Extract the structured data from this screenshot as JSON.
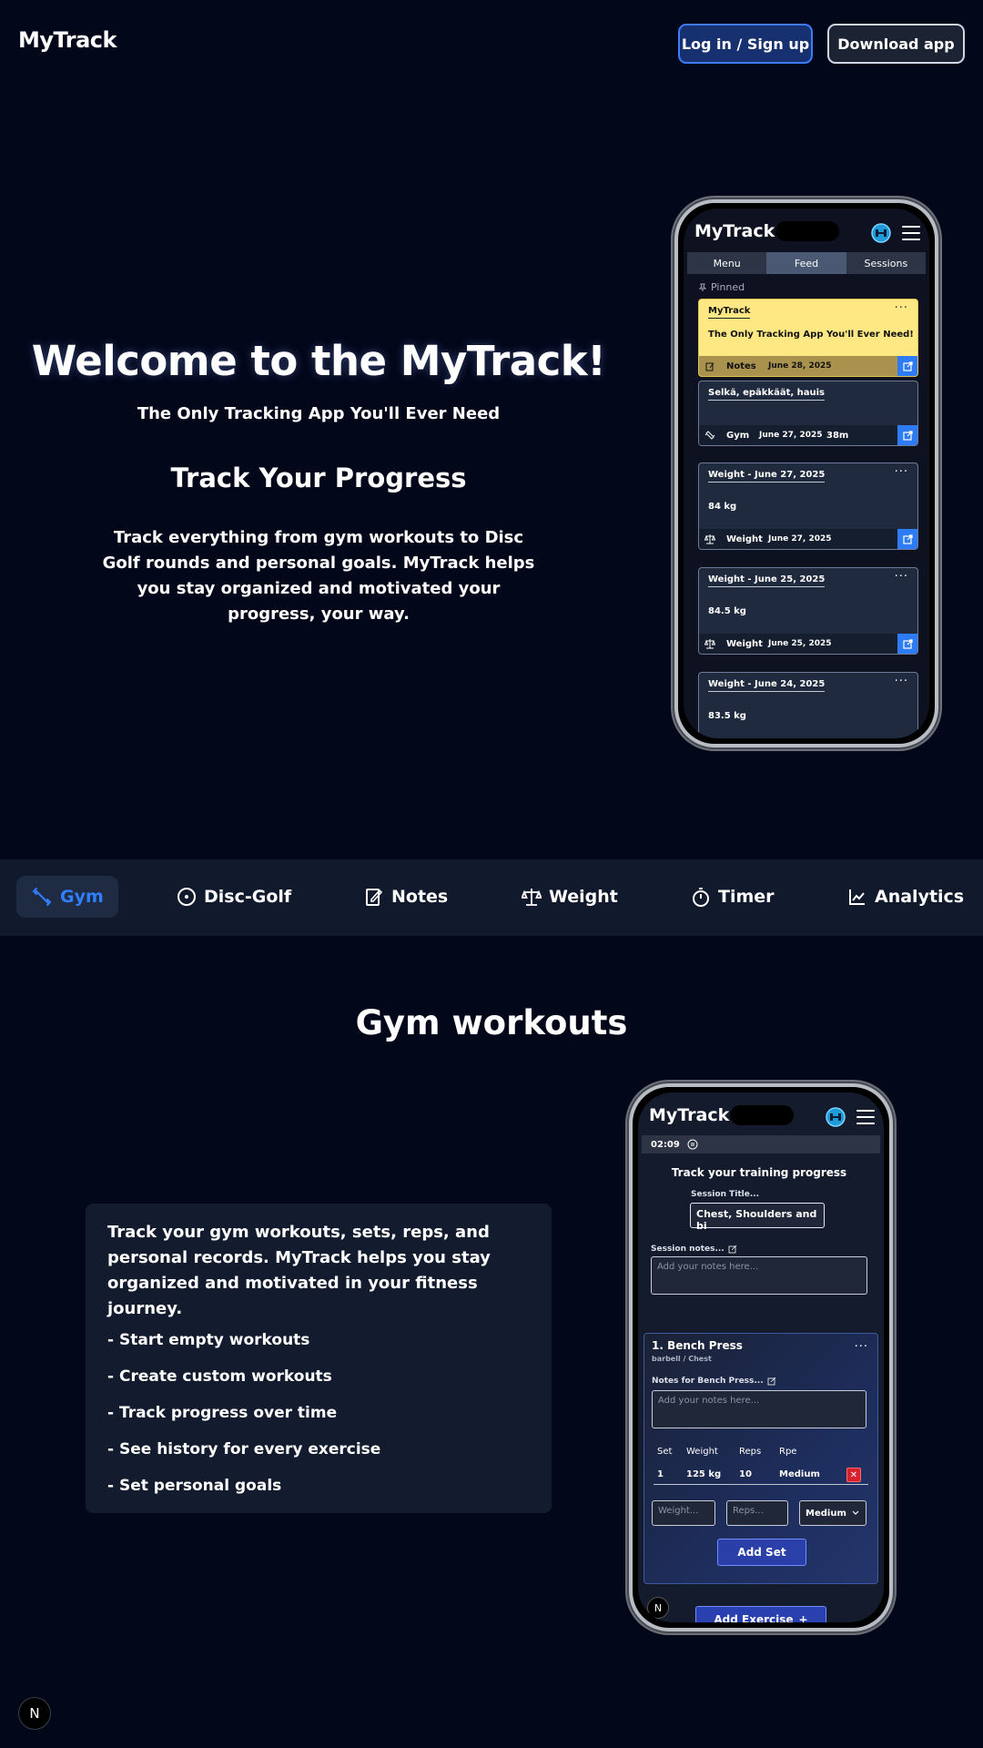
{
  "header": {
    "logo": "MyTrack",
    "login_label": "Log in / Sign up",
    "download_label": "Download app"
  },
  "hero": {
    "title": "Welcome to the MyTrack!",
    "subtitle": "The Only Tracking App You'll Ever Need",
    "heading": "Track Your Progress",
    "body": "Track everything from gym workouts to Disc Golf rounds and personal goals. MyTrack helps you stay organized and motivated your progress, your way."
  },
  "phone1": {
    "app_title": "MyTrack",
    "tabs": [
      "Menu",
      "Feed",
      "Sessions"
    ],
    "active_tab": "Feed",
    "pinned_label": "Pinned",
    "cards": [
      {
        "title": "MyTrack",
        "value": "The Only Tracking App You'll Ever Need!",
        "type": "Notes",
        "date": "June 28, 2025",
        "duration": "",
        "icon": "note-icon",
        "style": "yellow"
      },
      {
        "title": "Selkä, epäkkäät, hauis",
        "value": "",
        "type": "Gym",
        "date": "June 27, 2025",
        "duration": "38m",
        "icon": "dumbbell-icon",
        "style": "normal"
      },
      {
        "title": "Weight - June 27, 2025",
        "value": "84 kg",
        "type": "Weight",
        "date": "June 27, 2025",
        "duration": "",
        "icon": "scale-icon",
        "style": "normal"
      },
      {
        "title": "Weight - June 25, 2025",
        "value": "84.5 kg",
        "type": "Weight",
        "date": "June 25, 2025",
        "duration": "",
        "icon": "scale-icon",
        "style": "normal"
      },
      {
        "title": "Weight - June 24, 2025",
        "value": "83.5 kg",
        "type": "",
        "date": "",
        "duration": "",
        "icon": "",
        "style": "normal"
      }
    ]
  },
  "categories": [
    {
      "label": "Gym",
      "icon": "dumbbell-icon",
      "active": true
    },
    {
      "label": "Disc-Golf",
      "icon": "disc-icon",
      "active": false
    },
    {
      "label": "Notes",
      "icon": "notebook-icon",
      "active": false
    },
    {
      "label": "Weight",
      "icon": "scale-icon",
      "active": false
    },
    {
      "label": "Timer",
      "icon": "stopwatch-icon",
      "active": false
    },
    {
      "label": "Analytics",
      "icon": "chart-icon",
      "active": false
    }
  ],
  "gym": {
    "title": "Gym workouts",
    "description": "Track your gym workouts, sets, reps, and personal records. MyTrack helps you stay organized and motivated in your fitness journey.",
    "features": [
      "- Start empty workouts",
      "- Create custom workouts",
      "- Track progress over time",
      "- See history for every exercise",
      "- Set personal goals"
    ]
  },
  "phone2": {
    "app_title": "MyTrack",
    "timer": "02:09",
    "heading": "Track your training progress",
    "session_title_label": "Session Title...",
    "session_title_value": "Chest, Shoulders and bi",
    "session_notes_label": "Session notes...",
    "notes_placeholder": "Add your notes here...",
    "exercise": {
      "name": "1. Bench Press",
      "meta": "barbell / Chest",
      "notes_label": "Notes for Bench Press...",
      "notes_placeholder": "Add your notes here...",
      "columns": [
        "Set",
        "Weight",
        "Reps",
        "Rpe"
      ],
      "rows": [
        {
          "set": "1",
          "weight": "125 kg",
          "reps": "10",
          "rpe": "Medium"
        }
      ],
      "weight_placeholder": "Weight...",
      "reps_placeholder": "Reps...",
      "rpe_select": "Medium",
      "add_set_label": "Add Set"
    },
    "add_exercise_label": "Add Exercise",
    "badge": "N"
  },
  "footer_badge": "N",
  "colors": {
    "background": "#03071a",
    "accent": "#2f7fff",
    "pinned_card": "#fde883"
  }
}
